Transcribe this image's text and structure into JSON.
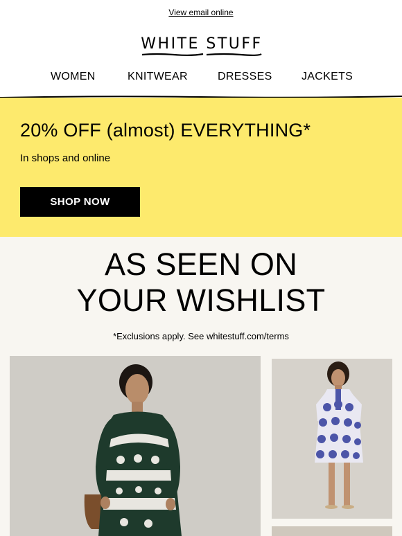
{
  "header": {
    "view_online": "View email online",
    "logo_text": "WHITE STUFF"
  },
  "nav": {
    "items": [
      "WOMEN",
      "KNITWEAR",
      "DRESSES",
      "JACKETS"
    ]
  },
  "promo": {
    "title": "20% OFF (almost) EVERYTHING*",
    "subtitle": "In shops and online",
    "button": "SHOP NOW",
    "bg_color": "#fdea6d"
  },
  "wishlist": {
    "title_line1": "AS SEEN ON",
    "title_line2": "YOUR WISHLIST",
    "note": "*Exclusions apply. See whitestuff.com/terms",
    "bg_color": "#f8f6f1"
  },
  "products": [
    {
      "image": "model in green and white patterned maxi dress"
    },
    {
      "image": "model in blue and white patterned short dress"
    },
    {
      "image": "product photo"
    }
  ]
}
